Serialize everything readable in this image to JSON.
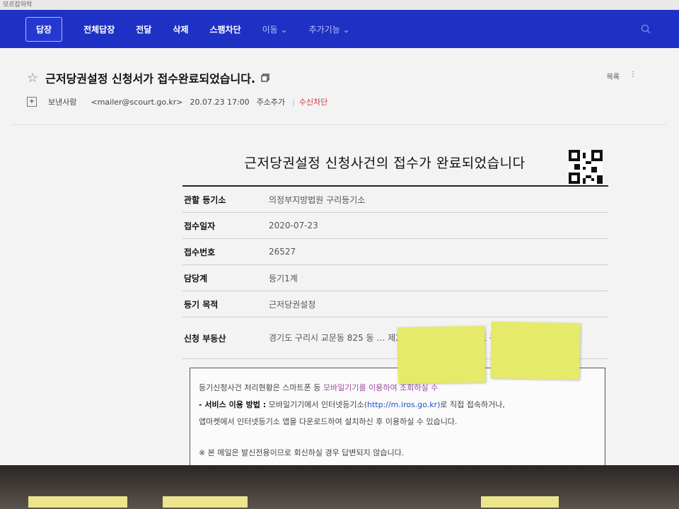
{
  "topbar_label": "모르잡하락",
  "toolbar": {
    "buttons": [
      "답장",
      "전체답장",
      "전달",
      "삭제",
      "스팸차단"
    ],
    "move_label": "이동 ⌄",
    "more_label": "추가기능 ⌄"
  },
  "email": {
    "subject": "근저당권설정 신청서가 접수완료되었습니다.",
    "list_label": "목록",
    "sender_label": "보낸사람",
    "sender_address": "<mailer@scourt.go.kr>",
    "datetime": "20.07.23 17:00",
    "add_address": "주소추가",
    "block_sender": "수신차단"
  },
  "body": {
    "title": "근저당권설정 신청사건의 접수가 완료되었습니다",
    "rows": [
      {
        "label": "관할 등기소",
        "value": "의정부지방법원 구리등기소"
      },
      {
        "label": "접수일자",
        "value": "2020-07-23"
      },
      {
        "label": "접수번호",
        "value": "26527"
      },
      {
        "label": "담당계",
        "value": "등기1계"
      },
      {
        "label": "등기 목적",
        "value": "근저당권설정"
      },
      {
        "label": "신청 부동산",
        "value": "경기도 구리시 교문동 825 동 … 제2 … (도로명주소) 경기도 구리시 장자대로 6…"
      }
    ],
    "notice": {
      "line1_prefix": "등기신청사건 처리현황은 스마트폰 등 ",
      "line1_highlight": "모바일기기를 이용하여 조회하실 수",
      "line2_label": "- 서비스 이용 방법 :",
      "line2_text": " 모바일기기에서 인터넷등기소",
      "line2_link": "(http://m.iros.go.kr)",
      "line2_suffix": "로 직접 접속하거나,",
      "line3": "앱마켓에서 인터넷등기소 앱을 다운로드하여 설치하신 후 이용하실 수 있습니다.",
      "line4": "※ 본 메일은 발신전용이므로 회신하실 경우 답변되지 않습니다."
    }
  },
  "colors": {
    "toolbar_bg": "#1f31c4",
    "block_red": "#d0343c",
    "link_blue": "#2250c8",
    "sticky_note": "#e6ea6a"
  }
}
